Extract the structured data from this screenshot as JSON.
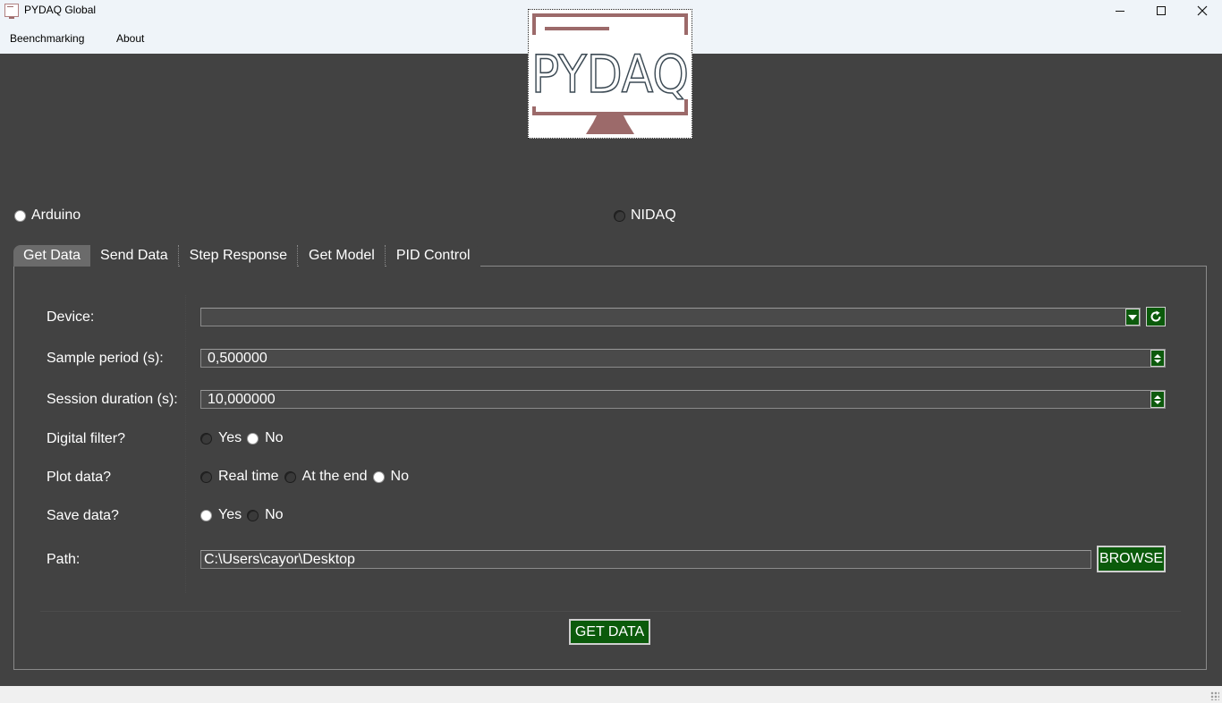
{
  "window": {
    "title": "PYDAQ Global",
    "controls": [
      "minimize-icon",
      "maximize-icon",
      "close-icon"
    ]
  },
  "menu": {
    "items": [
      "Beenchmarking",
      "About"
    ]
  },
  "logo": {
    "text": "PYDAQ",
    "colors": {
      "accent": "#9c6a6a",
      "text": "#3c4a54"
    }
  },
  "boards": {
    "arduino": {
      "label": "Arduino",
      "selected": false
    },
    "nidaq": {
      "label": "NIDAQ",
      "selected": false
    }
  },
  "tabs": [
    {
      "label": "Get Data",
      "active": true
    },
    {
      "label": "Send Data",
      "active": false
    },
    {
      "label": "Step Response",
      "active": false
    },
    {
      "label": "Get Model",
      "active": false
    },
    {
      "label": "PID Control",
      "active": false
    }
  ],
  "form": {
    "device": {
      "label": "Device:",
      "value": ""
    },
    "sample_period": {
      "label": "Sample period (s):",
      "value": "0,500000"
    },
    "session_duration": {
      "label": "Session duration (s):",
      "value": "10,000000"
    },
    "digital_filter": {
      "label": "Digital filter?",
      "options": [
        "Yes",
        "No"
      ]
    },
    "plot_data": {
      "label": "Plot data?",
      "options": [
        "Real time",
        "At the end",
        "No"
      ]
    },
    "save_data": {
      "label": "Save data?",
      "options": [
        "Yes",
        "No"
      ]
    },
    "path": {
      "label": "Path:",
      "value": "C:\\Users\\cayor\\Desktop"
    },
    "browse_label": "BROWSE",
    "get_data_label": "GET DATA"
  },
  "colors": {
    "background": "#424242",
    "button_green": "#0b5a0b",
    "active_tab": "#6b6b6b"
  }
}
